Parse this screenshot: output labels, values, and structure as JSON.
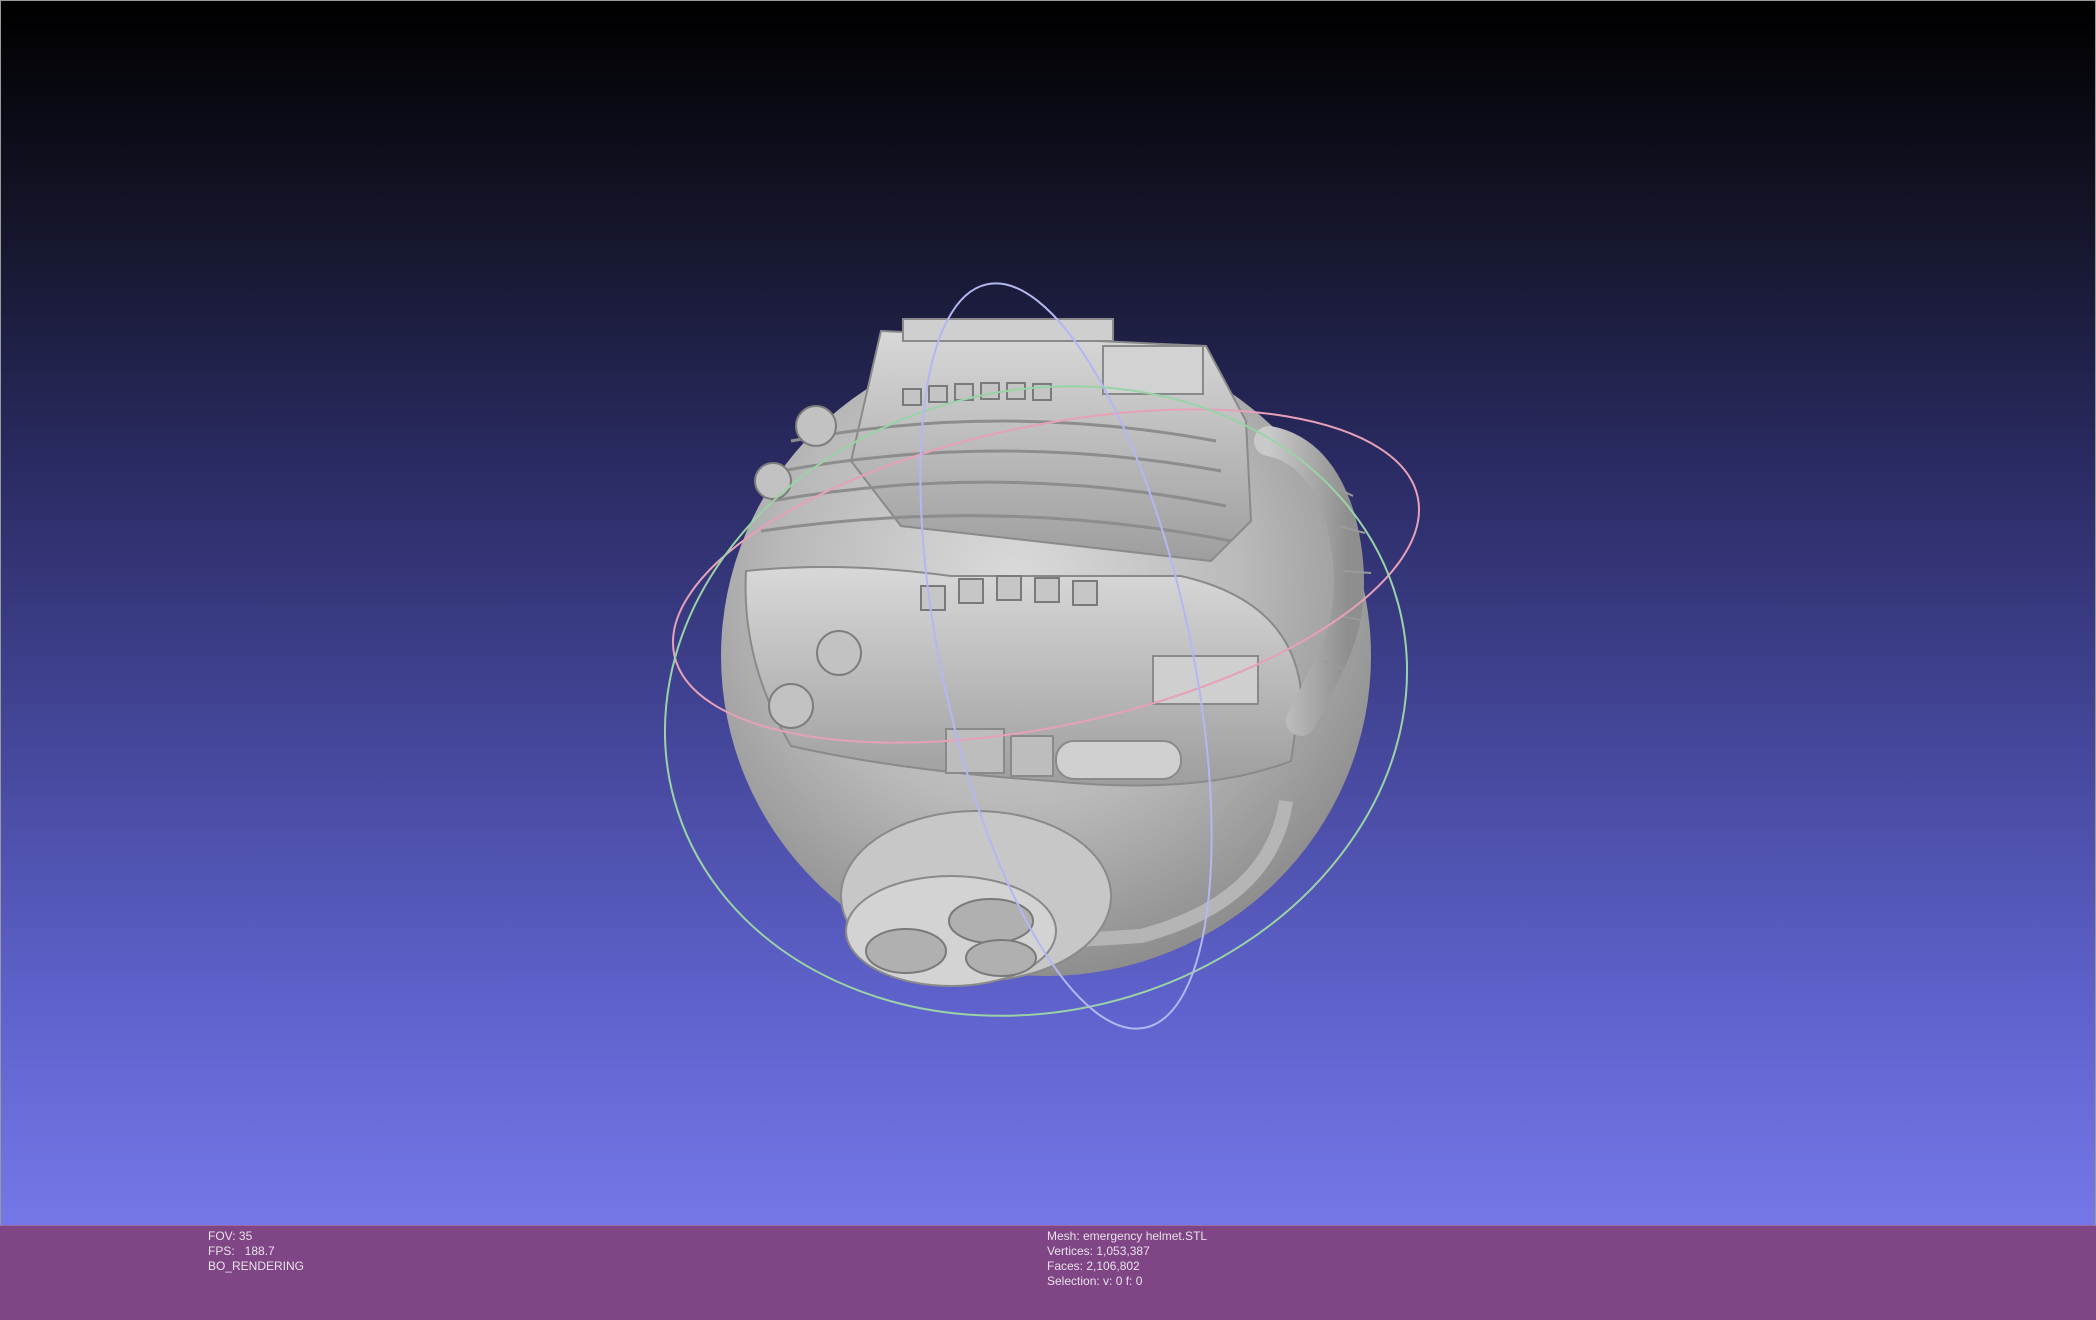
{
  "viewer": {
    "background_top": "#000000",
    "background_bottom": "#7577e8",
    "model_name": "emergency helmet"
  },
  "info_left": {
    "fov": "FOV: 35",
    "fps": "FPS:   188.7",
    "mode": "BO_RENDERING"
  },
  "info_right": {
    "mesh": "Mesh: emergency helmet.STL",
    "vertices": "Vertices: 1,053,387",
    "faces": "Faces: 2,106,802",
    "selection": "Selection: v: 0 f: 0"
  },
  "colors": {
    "info_bar": "#7f4585",
    "info_text": "#e8e2ea",
    "trackball_x": "#e6a0b8",
    "trackball_y": "#9ad3a6",
    "trackball_z": "#b4b7f2"
  }
}
